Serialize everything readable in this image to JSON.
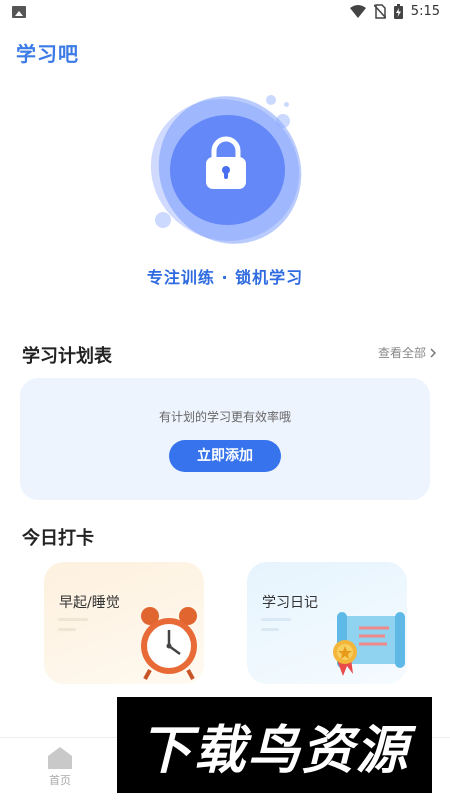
{
  "status_bar": {
    "time": "5:15",
    "icons": [
      "image-icon",
      "wifi-icon",
      "no-sim-icon",
      "battery-charging-icon"
    ]
  },
  "app": {
    "title": "学习吧"
  },
  "hero": {
    "caption": "专注训练 · 锁机学习",
    "icon": "lock-icon"
  },
  "plan": {
    "title": "学习计划表",
    "view_all": "查看全部",
    "hint": "有计划的学习更有效率哦",
    "add_button": "立即添加"
  },
  "checkin": {
    "title": "今日打卡",
    "cards": [
      {
        "label": "早起/睡觉",
        "icon": "alarm-clock-icon"
      },
      {
        "label": "学习日记",
        "icon": "certificate-scroll-icon"
      }
    ]
  },
  "bottom_nav": {
    "items": [
      {
        "label": "首页",
        "icon": "home-icon"
      }
    ]
  },
  "watermark": {
    "text": "下载鸟资源"
  },
  "colors": {
    "primary": "#3673ec",
    "title": "#3c7be6",
    "card_bg": "#eef4fd"
  }
}
